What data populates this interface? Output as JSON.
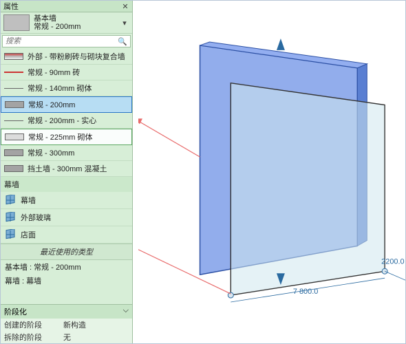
{
  "panel": {
    "title": "属性",
    "close_label": "✕",
    "family": {
      "name": "基本墙",
      "type": "常规 - 200mm"
    },
    "search_placeholder": "搜索",
    "search_icon": "🔍"
  },
  "types": {
    "items": [
      {
        "label": "外部 - 带粉刷砖与砌块复合墙",
        "swatch": "gradient"
      },
      {
        "label": "常规 - 90mm 砖",
        "swatch": "line"
      },
      {
        "label": "常规 - 140mm 砌体",
        "swatch": "dark0"
      },
      {
        "label": "常规 - 200mm",
        "swatch": "darkbox",
        "highlight": 1
      },
      {
        "label": "常规 - 200mm - 实心",
        "swatch": "dark0"
      },
      {
        "label": "常规 - 225mm 砌体",
        "swatch": "plain",
        "highlight": 2
      },
      {
        "label": "常规 - 300mm",
        "swatch": "darkbox"
      },
      {
        "label": "挡土墙 - 300mm 混凝土",
        "swatch": "darkbox"
      }
    ],
    "curtain_head": "幕墙",
    "curtain_items": [
      {
        "label": "幕墙"
      },
      {
        "label": "外部玻璃"
      },
      {
        "label": "店面"
      }
    ]
  },
  "recent": {
    "head": "最近使用的类型",
    "items": [
      "基本墙 : 常规 - 200mm",
      "幕墙 : 幕墙"
    ]
  },
  "phasing": {
    "head": "阶段化",
    "rows": [
      {
        "k": "创建的阶段",
        "v": "新构造"
      },
      {
        "k": "拆除的阶段",
        "v": "无"
      }
    ]
  },
  "viewport": {
    "dim_h": "7 800.0",
    "dim_w": "2200.0"
  }
}
